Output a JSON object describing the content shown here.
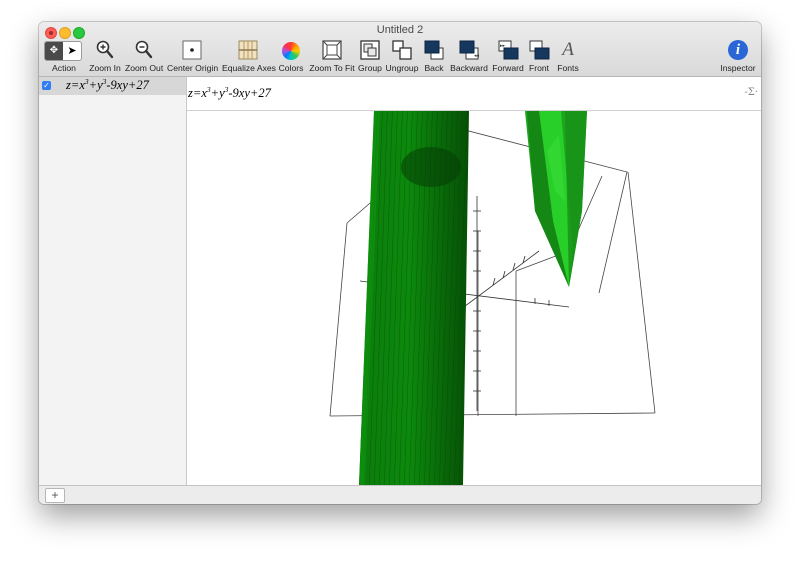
{
  "window": {
    "title": "Untitled 2"
  },
  "toolbar": {
    "action": "Action",
    "zoom_in": "Zoom In",
    "zoom_out": "Zoom Out",
    "center_origin": "Center Origin",
    "equalize_axes": "Equalize Axes",
    "colors": "Colors",
    "zoom_to_fit": "Zoom To Fit",
    "group": "Group",
    "ungroup": "Ungroup",
    "back": "Back",
    "backward": "Backward",
    "forward": "Forward",
    "front": "Front",
    "fonts": "Fonts",
    "inspector": "Inspector"
  },
  "sidebar": {
    "equations": [
      {
        "checked": true,
        "lhs": "z",
        "eq": "=",
        "b1": "x",
        "e1": "3",
        "plus": "+",
        "b2": "y",
        "e2": "3",
        "rest": "-9xy+27"
      }
    ]
  },
  "editor": {
    "lhs": "z",
    "eq": "=",
    "b1": "x",
    "e1": "3",
    "plus": "+",
    "b2": "y",
    "e2": "3",
    "rest": "-9xy+27",
    "sigma": "-Σ·"
  },
  "bottom": {
    "add": "+"
  },
  "colors": {
    "surface_dark": "#0a6b0a",
    "surface": "#1f9b1f",
    "surface_light": "#2bd02b",
    "accent": "#2f7cf6"
  },
  "icons": [
    "action-menu-icon",
    "pointer-icon",
    "zoom-in-icon",
    "zoom-out-icon",
    "center-origin-icon",
    "equalize-axes-icon",
    "colors-icon",
    "zoom-to-fit-icon",
    "group-icon",
    "ungroup-icon",
    "back-icon",
    "backward-icon",
    "forward-icon",
    "front-icon",
    "fonts-icon",
    "inspector-icon"
  ]
}
